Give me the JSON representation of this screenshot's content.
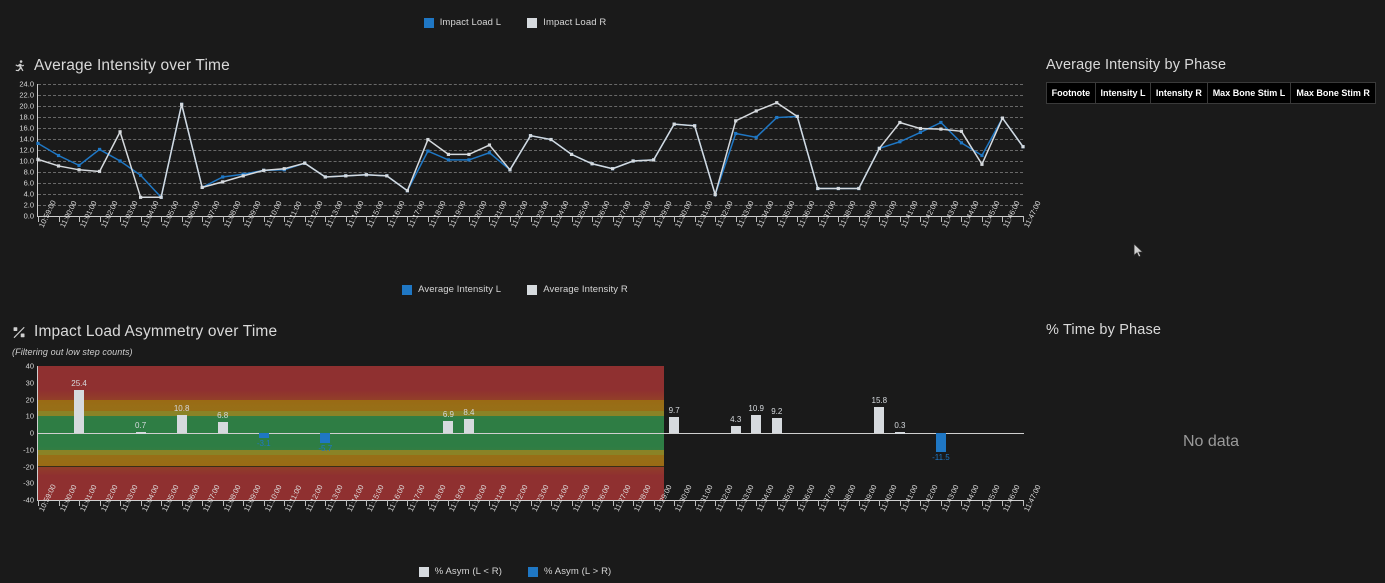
{
  "top_legend": {
    "items": [
      {
        "label": "Impact Load L",
        "color": "#1f77c4",
        "icon": "square-swatch-blue"
      },
      {
        "label": "Impact Load R",
        "color": "#d6dade",
        "icon": "square-swatch-gray"
      }
    ]
  },
  "intensity_panel": {
    "title": "Average Intensity over Time",
    "icon": "running-person-icon",
    "legend": [
      {
        "label": "Average Intensity L",
        "color": "#1f77c4",
        "icon": "square-swatch-blue"
      },
      {
        "label": "Average Intensity R",
        "color": "#d6dade",
        "icon": "square-swatch-gray"
      }
    ]
  },
  "asymmetry_panel": {
    "title": "Impact Load Asymmetry over Time",
    "subtitle": "(Filtering out low step counts)",
    "icon": "percent-asymmetry-icon",
    "legend": [
      {
        "label": "% Asym (L < R)",
        "color": "#d6dade",
        "icon": "square-swatch-gray"
      },
      {
        "label": "% Asym (L > R)",
        "color": "#1f77c4",
        "icon": "square-swatch-blue"
      }
    ]
  },
  "phase_table_panel": {
    "title": "Average Intensity by Phase",
    "columns": [
      "Footnote",
      "Intensity L",
      "Intensity R",
      "Max Bone Stim L",
      "Max Bone Stim R"
    ],
    "rows": []
  },
  "time_by_phase_panel": {
    "title": "% Time by Phase",
    "empty_message": "No data"
  },
  "colors": {
    "background": "#1a1a1a",
    "series_left": "#1f77c4",
    "series_right": "#d6dade",
    "zone_good": "#2e7d44",
    "zone_warn": "#8a8326",
    "zone_warn2": "#9a6a14",
    "zone_bad": "#8f3030",
    "axis": "#cfcfcf",
    "grid": "rgba(225,225,225,0.40)"
  },
  "chart_data": [
    {
      "id": "average-intensity-over-time",
      "type": "line",
      "title": "Average Intensity over Time",
      "xlabel": "",
      "ylabel": "",
      "ylim": [
        0.0,
        24.0
      ],
      "ytick_step": 2.0,
      "yticks": [
        "24.0",
        "22.0",
        "20.0",
        "18.0",
        "16.0",
        "14.0",
        "12.0",
        "10.0",
        "8.0",
        "6.0",
        "4.0",
        "2.0",
        "0.0"
      ],
      "grid": true,
      "legend_position": "bottom",
      "categories": [
        "10:59:00",
        "11:00:00",
        "11:01:00",
        "11:02:00",
        "11:03:00",
        "11:04:00",
        "11:05:00",
        "11:06:00",
        "11:07:00",
        "11:08:00",
        "11:09:00",
        "11:10:00",
        "11:11:00",
        "11:12:00",
        "11:13:00",
        "11:14:00",
        "11:15:00",
        "11:16:00",
        "11:17:00",
        "11:18:00",
        "11:19:00",
        "11:20:00",
        "11:21:00",
        "11:22:00",
        "11:23:00",
        "11:24:00",
        "11:25:00",
        "11:26:00",
        "11:27:00",
        "11:28:00",
        "11:29:00",
        "11:30:00",
        "11:31:00",
        "11:32:00",
        "11:33:00",
        "11:34:00",
        "11:35:00",
        "11:36:00",
        "11:37:00",
        "11:38:00",
        "11:39:00",
        "11:40:00",
        "11:41:00",
        "11:42:00",
        "11:43:00",
        "11:44:00",
        "11:45:00",
        "11:46:00",
        "11:47:00"
      ],
      "series": [
        {
          "name": "Average Intensity L",
          "color": "#1f77c4",
          "values": [
            13.2,
            11.0,
            9.2,
            12.1,
            10.0,
            7.4,
            3.4,
            20.3,
            5.2,
            7.1,
            7.6,
            8.3,
            8.4,
            9.6,
            7.1,
            7.3,
            7.5,
            7.3,
            4.6,
            11.8,
            10.2,
            10.2,
            11.5,
            8.4,
            14.6,
            13.9,
            11.2,
            9.5,
            8.6,
            10.0,
            10.2,
            16.7,
            16.4,
            3.9,
            15.0,
            14.3,
            17.9,
            18.1,
            5.0,
            5.0,
            5.0,
            12.3,
            13.5,
            15.2,
            17.0,
            13.3,
            11.0,
            17.8,
            12.6
          ]
        },
        {
          "name": "Average Intensity R",
          "color": "#d6dade",
          "values": [
            10.3,
            9.1,
            8.4,
            8.1,
            15.3,
            3.4,
            3.4,
            20.3,
            5.2,
            6.2,
            7.3,
            8.3,
            8.6,
            9.6,
            7.1,
            7.3,
            7.5,
            7.3,
            4.6,
            13.9,
            11.2,
            11.2,
            12.9,
            8.4,
            14.6,
            13.9,
            11.2,
            9.5,
            8.6,
            10.0,
            10.2,
            16.7,
            16.4,
            3.9,
            17.3,
            19.1,
            20.6,
            18.1,
            5.0,
            5.0,
            5.0,
            12.3,
            17.0,
            15.9,
            15.8,
            15.4,
            9.4,
            17.8,
            12.6
          ]
        }
      ]
    },
    {
      "id": "impact-load-asymmetry-over-time",
      "type": "bar",
      "title": "Impact Load Asymmetry over Time",
      "subtitle": "(Filtering out low step counts)",
      "xlabel": "",
      "ylabel": "",
      "ylim": [
        -40,
        40
      ],
      "ytick_step": 10,
      "yticks": [
        "40",
        "30",
        "20",
        "10",
        "0",
        "-10",
        "-20",
        "-30",
        "-40"
      ],
      "grid": false,
      "legend_position": "bottom",
      "zones": [
        {
          "label": "bad-high",
          "from": 20,
          "to": 40,
          "color": "#8f3030"
        },
        {
          "label": "warn-high",
          "from": 13,
          "to": 20,
          "color": "#9a6a14"
        },
        {
          "label": "caut-high",
          "from": 10,
          "to": 13,
          "color": "#8a8326"
        },
        {
          "label": "good",
          "from": -10,
          "to": 10,
          "color": "#2e7d44"
        },
        {
          "label": "caut-low",
          "from": -13,
          "to": -10,
          "color": "#8a8326"
        },
        {
          "label": "warn-low",
          "from": -20,
          "to": -13,
          "color": "#9a6a14"
        },
        {
          "label": "bad-low",
          "from": -40,
          "to": -20,
          "color": "#8f3030"
        }
      ],
      "zone_x_end_category": "11:29:00",
      "categories": [
        "10:59:00",
        "11:00:00",
        "11:01:00",
        "11:02:00",
        "11:03:00",
        "11:04:00",
        "11:05:00",
        "11:06:00",
        "11:07:00",
        "11:08:00",
        "11:09:00",
        "11:10:00",
        "11:11:00",
        "11:12:00",
        "11:13:00",
        "11:14:00",
        "11:15:00",
        "11:16:00",
        "11:17:00",
        "11:18:00",
        "11:19:00",
        "11:20:00",
        "11:21:00",
        "11:22:00",
        "11:23:00",
        "11:24:00",
        "11:25:00",
        "11:26:00",
        "11:27:00",
        "11:28:00",
        "11:29:00",
        "11:30:00",
        "11:31:00",
        "11:32:00",
        "11:33:00",
        "11:34:00",
        "11:35:00",
        "11:36:00",
        "11:37:00",
        "11:38:00",
        "11:39:00",
        "11:40:00",
        "11:41:00",
        "11:42:00",
        "11:43:00",
        "11:44:00",
        "11:45:00",
        "11:46:00",
        "11:47:00"
      ],
      "bars": [
        {
          "category": "11:01:00",
          "value": 25.4,
          "label": "25.4",
          "series": "% Asym (L < R)",
          "color": "#d6dade"
        },
        {
          "category": "11:04:00",
          "value": 0.7,
          "label": "0.7",
          "series": "% Asym (L < R)",
          "color": "#d6dade"
        },
        {
          "category": "11:06:00",
          "value": 10.8,
          "label": "10.8",
          "series": "% Asym (L < R)",
          "color": "#d6dade"
        },
        {
          "category": "11:08:00",
          "value": 6.8,
          "label": "6.8",
          "series": "% Asym (L < R)",
          "color": "#d6dade"
        },
        {
          "category": "11:10:00",
          "value": -3.1,
          "label": "-3.1",
          "series": "% Asym (L > R)",
          "color": "#1f77c4"
        },
        {
          "category": "11:13:00",
          "value": -5.7,
          "label": "-5.7",
          "series": "% Asym (L > R)",
          "color": "#1f77c4"
        },
        {
          "category": "11:19:00",
          "value": 6.9,
          "label": "6.9",
          "series": "% Asym (L < R)",
          "color": "#d6dade"
        },
        {
          "category": "11:20:00",
          "value": 8.4,
          "label": "8.4",
          "series": "% Asym (L < R)",
          "color": "#d6dade"
        },
        {
          "category": "11:30:00",
          "value": 9.7,
          "label": "9.7",
          "series": "% Asym (L < R)",
          "color": "#d6dade"
        },
        {
          "category": "11:33:00",
          "value": 4.3,
          "label": "4.3",
          "series": "% Asym (L < R)",
          "color": "#d6dade"
        },
        {
          "category": "11:34:00",
          "value": 10.9,
          "label": "10.9",
          "series": "% Asym (L < R)",
          "color": "#d6dade"
        },
        {
          "category": "11:35:00",
          "value": 9.2,
          "label": "9.2",
          "series": "% Asym (L < R)",
          "color": "#d6dade"
        },
        {
          "category": "11:40:00",
          "value": 15.8,
          "label": "15.8",
          "series": "% Asym (L < R)",
          "color": "#d6dade"
        },
        {
          "category": "11:41:00",
          "value": 0.3,
          "label": "0.3",
          "series": "% Asym (L < R)",
          "color": "#d6dade"
        },
        {
          "category": "11:43:00",
          "value": -11.5,
          "label": "-11.5",
          "series": "% Asym (L > R)",
          "color": "#1f77c4"
        }
      ]
    }
  ]
}
